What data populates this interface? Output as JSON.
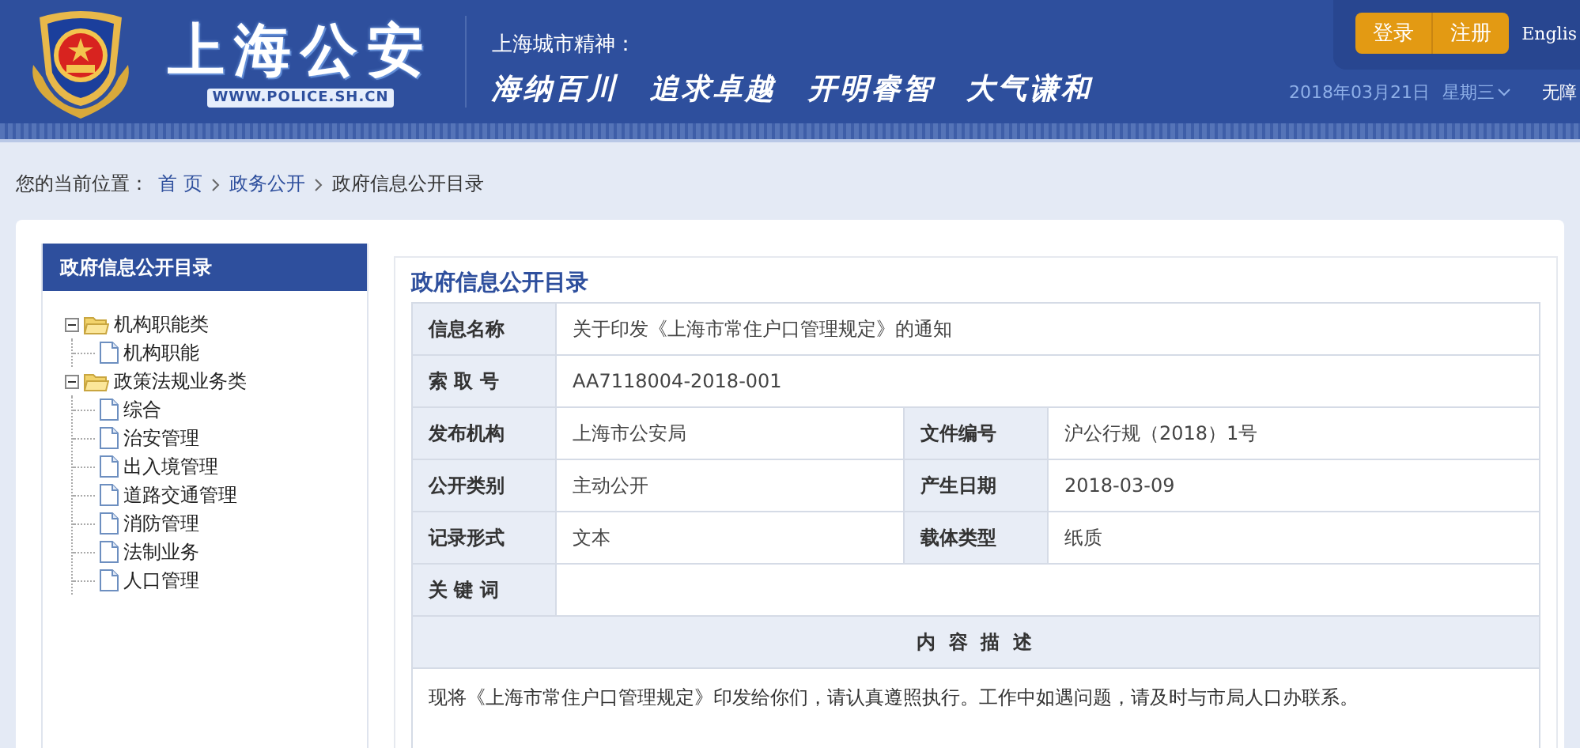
{
  "header": {
    "logo_title": "上海公安",
    "logo_url": "WWW.POLICE.SH.CN",
    "motto_label": "上海城市精神：",
    "motto": [
      "海纳百川",
      "追求卓越",
      "开明睿智",
      "大气谦和"
    ],
    "auth_buttons": [
      "登录",
      "注册"
    ],
    "language": "Englis",
    "date": "2018年03月21日",
    "weekday": "星期三",
    "accessibility": "无障"
  },
  "breadcrumb": {
    "label": "您的当前位置：",
    "items": [
      "首 页",
      "政务公开",
      "政府信息公开目录"
    ]
  },
  "sidebar": {
    "title": "政府信息公开目录",
    "tree": [
      {
        "label": "机构职能类",
        "expanded": true,
        "children": [
          {
            "label": "机构职能"
          }
        ]
      },
      {
        "label": "政策法规业务类",
        "expanded": true,
        "children": [
          {
            "label": "综合"
          },
          {
            "label": "治安管理"
          },
          {
            "label": "出入境管理"
          },
          {
            "label": "道路交通管理"
          },
          {
            "label": "消防管理"
          },
          {
            "label": "法制业务"
          },
          {
            "label": "人口管理"
          }
        ]
      }
    ]
  },
  "detail": {
    "title": "政府信息公开目录",
    "rows": [
      [
        {
          "label": "信息名称",
          "value": "关于印发《上海市常住户口管理规定》的通知"
        }
      ],
      [
        {
          "label": "索 取 号",
          "value": "AA7118004-2018-001"
        }
      ],
      [
        {
          "label": "发布机构",
          "value": "上海市公安局"
        },
        {
          "label": "文件编号",
          "value": "沪公行规（2018）1号"
        }
      ],
      [
        {
          "label": "公开类别",
          "value": "主动公开"
        },
        {
          "label": "产生日期",
          "value": "2018-03-09"
        }
      ],
      [
        {
          "label": "记录形式",
          "value": "文本"
        },
        {
          "label": "载体类型",
          "value": "纸质"
        }
      ],
      [
        {
          "label": "关 键 词"
        }
      ]
    ],
    "section_title": "内 容 描 述",
    "description": "现将《上海市常住户口管理规定》印发给你们，请认真遵照执行。工作中如遇问题，请及时与市局人口办联系。"
  }
}
